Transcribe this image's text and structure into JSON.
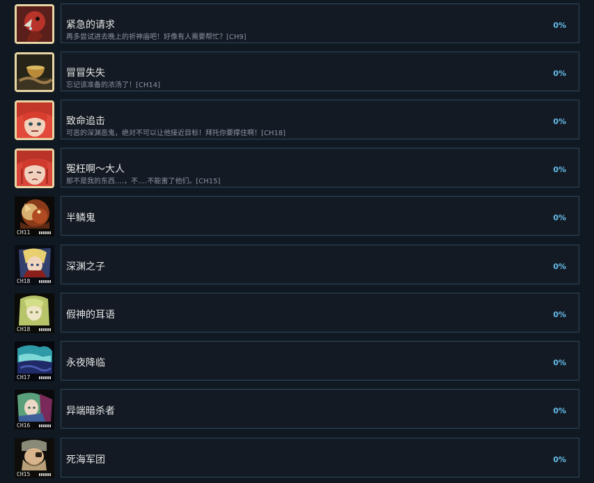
{
  "achievements": [
    {
      "title": "紧急的请求",
      "description": "再多尝试进去晚上的祈神庙吧！好像有人需要帮忙？[CH9]",
      "percent": "0%",
      "icon": "red-bird-portrait-icon"
    },
    {
      "title": "冒冒失失",
      "description": "忘记该准备的浓汤了！[CH14]",
      "percent": "0%",
      "icon": "soup-bowl-icon"
    },
    {
      "title": "致命追击",
      "description": "可恶的深渊恶鬼，绝对不可以让他接近目标！拜托你要撑住啊！[CH18]",
      "percent": "0%",
      "icon": "red-hair-girl-angry-icon"
    },
    {
      "title": "冤枉啊～大人",
      "description": "那不是我的东西….，不….不能害了他们。[CH15]",
      "percent": "0%",
      "icon": "red-hair-girl-sad-icon"
    },
    {
      "title": "半鳞鬼",
      "description": "",
      "percent": "0%",
      "icon": "scaled-demon-portrait-icon",
      "chapter_tag": "CH11"
    },
    {
      "title": "深渊之子",
      "description": "",
      "percent": "0%",
      "icon": "blond-boy-portrait-icon",
      "chapter_tag": "CH18"
    },
    {
      "title": "假神的耳语",
      "description": "",
      "percent": "0%",
      "icon": "green-hair-figure-portrait-icon",
      "chapter_tag": "CH18"
    },
    {
      "title": "永夜降临",
      "description": "",
      "percent": "0%",
      "icon": "night-sky-icon",
      "chapter_tag": "CH17"
    },
    {
      "title": "异端暗杀者",
      "description": "",
      "percent": "0%",
      "icon": "green-hair-assassin-portrait-icon",
      "chapter_tag": "CH16"
    },
    {
      "title": "死海军团",
      "description": "",
      "percent": "0%",
      "icon": "bearded-soldier-portrait-icon",
      "chapter_tag": "CH15"
    }
  ]
}
